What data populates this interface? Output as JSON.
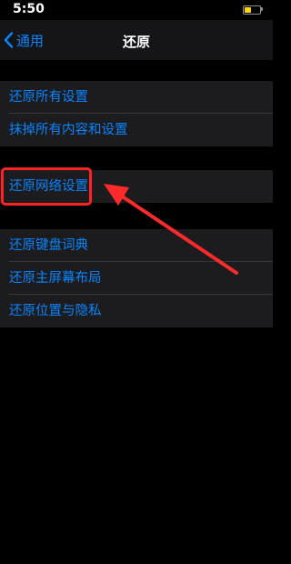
{
  "status_bar": {
    "time": "5:50",
    "battery_color": "#ffd60a"
  },
  "nav": {
    "back_label": "通用",
    "title": "还原"
  },
  "groups": [
    {
      "items": [
        {
          "label": "还原所有设置"
        },
        {
          "label": "抹掉所有内容和设置"
        }
      ]
    },
    {
      "items": [
        {
          "label": "还原网络设置"
        }
      ]
    },
    {
      "items": [
        {
          "label": "还原键盘词典"
        },
        {
          "label": "还原主屏幕布局"
        },
        {
          "label": "还原位置与隐私"
        }
      ]
    }
  ],
  "annotation": {
    "highlight_color": "#ff2222",
    "arrow_color": "#ff2a2a"
  },
  "colors": {
    "accent": "#0a84ff",
    "background": "#000000",
    "cell": "#1c1c1e"
  }
}
